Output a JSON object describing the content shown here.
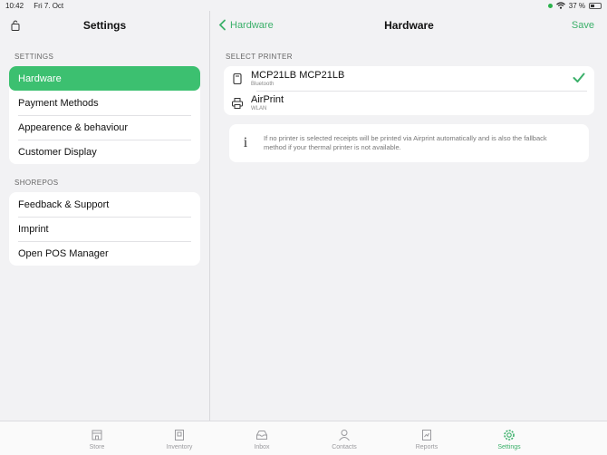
{
  "status": {
    "time": "10:42",
    "date": "Fri 7. Oct",
    "battery": "37 %",
    "battery_level": 0.37
  },
  "sidebar": {
    "title": "Settings",
    "sections": [
      {
        "label": "SETTINGS",
        "items": [
          "Hardware",
          "Payment Methods",
          "Appearence & behaviour",
          "Customer Display"
        ]
      },
      {
        "label": "SHOREPOS",
        "items": [
          "Feedback & Support",
          "Imprint",
          "Open POS Manager"
        ]
      }
    ],
    "active_item": "Hardware"
  },
  "detail": {
    "back_label": "Hardware",
    "title": "Hardware",
    "save_label": "Save",
    "section_label": "SELECT PRINTER",
    "printers": [
      {
        "name": "MCP21LB MCP21LB",
        "type": "Bluetooth",
        "selected": true,
        "icon": "device-icon"
      },
      {
        "name": "AirPrint",
        "type": "WLAN",
        "selected": false,
        "icon": "printer-icon"
      }
    ],
    "info_icon": "i",
    "info_text_line1": "If no printer is selected receipts will be printed via Airprint automatically and is also the fallback",
    "info_text_line2": "method if your thermal printer is not available."
  },
  "tabs": [
    {
      "label": "Store",
      "icon": "store-icon"
    },
    {
      "label": "Inventory",
      "icon": "inventory-icon"
    },
    {
      "label": "Inbox",
      "icon": "inbox-icon"
    },
    {
      "label": "Contacts",
      "icon": "contacts-icon"
    },
    {
      "label": "Reports",
      "icon": "reports-icon"
    },
    {
      "label": "Settings",
      "icon": "settings-icon"
    }
  ],
  "colors": {
    "accent": "#3bb06a",
    "active_row": "#3cc070",
    "background": "#f2f2f4"
  }
}
